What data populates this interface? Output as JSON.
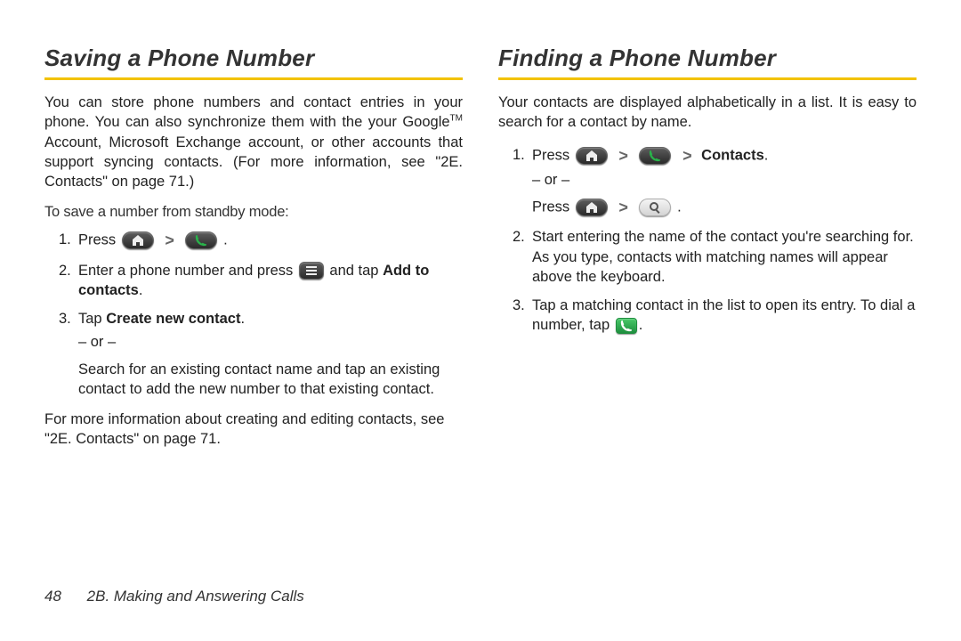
{
  "left": {
    "title": "Saving a Phone Number",
    "intro_a": "You can store phone numbers and contact entries in your phone. You can also synchronize them with the your Google",
    "intro_b": " Account, Microsoft Exchange account, or other accounts that support syncing contacts. (For more information, see \"2E. Contacts\" on page 71.)",
    "tm": "TM",
    "subhead": "To save a number from standby mode:",
    "step1_prefix": "Press ",
    "step1_suffix": ".",
    "step2_a": "Enter a phone number and press ",
    "step2_b": " and tap ",
    "step2_bold": "Add to contacts",
    "step2_c": ".",
    "step3_a": "Tap ",
    "step3_bold": "Create new contact",
    "step3_b": ".",
    "or": "– or –",
    "step3_alt": "Search for an existing contact name and tap an existing contact to add the new number to that existing contact.",
    "after": "For more information about creating and editing contacts, see \"2E. Contacts\" on page 71."
  },
  "right": {
    "title": "Finding a Phone Number",
    "intro": "Your contacts are displayed alphabetically in a list. It is easy to search for a contact by name.",
    "step1_prefix": "Press ",
    "step1_bold": "Contacts",
    "step1_suffix": ".",
    "or": "– or –",
    "step1_alt_a": "Press ",
    "step1_alt_b": ".",
    "step2": "Start entering the name of the contact you're searching for. As you type, contacts with matching names will appear above the keyboard.",
    "step3_a": "Tap a matching contact in the list to open its entry. To dial a number, tap ",
    "step3_b": "."
  },
  "footer": {
    "page": "48",
    "section": "2B. Making and Answering Calls"
  },
  "nums": {
    "n1": "1.",
    "n2": "2.",
    "n3": "3."
  },
  "sym": {
    "gt": ">"
  }
}
